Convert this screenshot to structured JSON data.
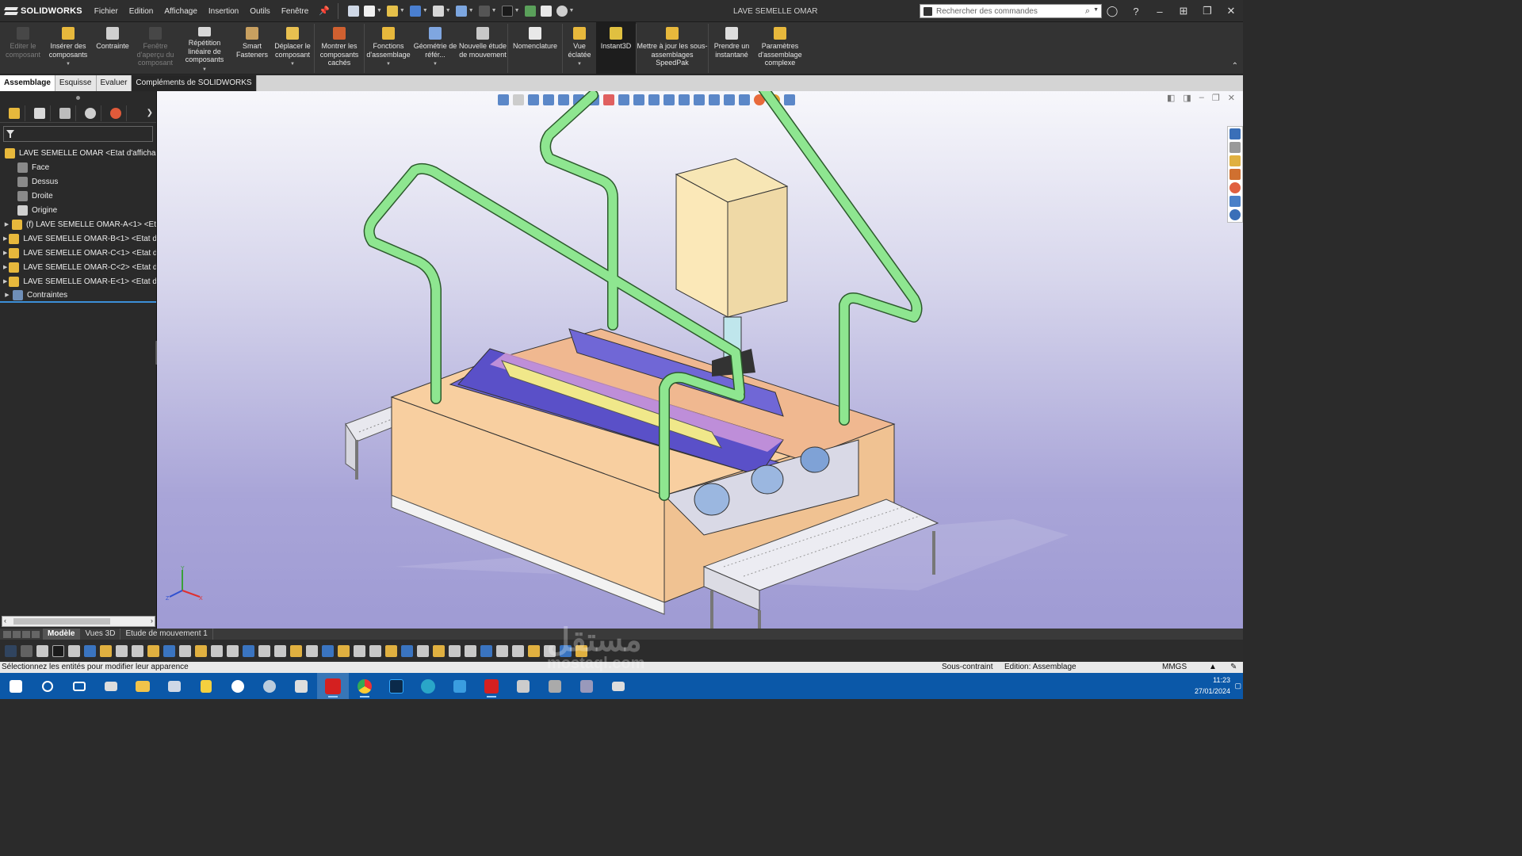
{
  "app": {
    "name": "SOLIDWORKS",
    "document_title": "LAVE SEMELLE OMAR"
  },
  "menu": [
    "Fichier",
    "Edition",
    "Affichage",
    "Insertion",
    "Outils",
    "Fenêtre"
  ],
  "search": {
    "placeholder": "Rechercher des commandes"
  },
  "ribbon": [
    {
      "label": "Editer le composant",
      "disabled": true,
      "icon": "edit-component-icon"
    },
    {
      "label": "Insérer des composants",
      "disabled": false,
      "icon": "insert-components-icon"
    },
    {
      "label": "Contrainte",
      "disabled": false,
      "icon": "mate-icon"
    },
    {
      "label": "Fenêtre d'aperçu du composant",
      "disabled": true,
      "icon": "preview-window-icon"
    },
    {
      "label": "Répétition linéaire de composants",
      "disabled": false,
      "icon": "linear-pattern-icon"
    },
    {
      "label": "Smart Fasteners",
      "disabled": false,
      "icon": "smart-fasteners-icon"
    },
    {
      "label": "Déplacer le composant",
      "disabled": false,
      "icon": "move-component-icon"
    },
    {
      "label": "Montrer les composants cachés",
      "disabled": false,
      "icon": "show-hidden-icon"
    },
    {
      "label": "Fonctions d'assemblage",
      "disabled": false,
      "icon": "assembly-features-icon"
    },
    {
      "label": "Géométrie de référ...",
      "disabled": false,
      "icon": "reference-geometry-icon"
    },
    {
      "label": "Nouvelle étude de mouvement",
      "disabled": false,
      "icon": "motion-study-icon"
    },
    {
      "label": "Nomenclature",
      "disabled": false,
      "icon": "bom-icon"
    },
    {
      "label": "Vue éclatée",
      "disabled": false,
      "icon": "exploded-view-icon"
    },
    {
      "label": "Instant3D",
      "disabled": false,
      "icon": "instant3d-icon",
      "selected": true
    },
    {
      "label": "Mettre à jour les sous-assemblages SpeedPak",
      "disabled": false,
      "icon": "speedpak-icon"
    },
    {
      "label": "Prendre un instantané",
      "disabled": false,
      "icon": "snapshot-icon"
    },
    {
      "label": "Paramètres d'assemblage complexe",
      "disabled": false,
      "icon": "large-assembly-icon"
    }
  ],
  "command_tabs": [
    "Assemblage",
    "Esquisse",
    "Evaluer",
    "Compléments de SOLIDWORKS"
  ],
  "feature_tree": {
    "root": "LAVE SEMELLE OMAR <Etat d'affichage-",
    "items": [
      {
        "label": "Face",
        "icon": "plane-icon",
        "expandable": false
      },
      {
        "label": "Dessus",
        "icon": "plane-icon",
        "expandable": false
      },
      {
        "label": "Droite",
        "icon": "plane-icon",
        "expandable": false
      },
      {
        "label": "Origine",
        "icon": "origin-icon",
        "expandable": false
      },
      {
        "label": "(f) LAVE SEMELLE OMAR-A<1> <Et",
        "icon": "part-icon",
        "expandable": true
      },
      {
        "label": "LAVE SEMELLE OMAR-B<1> <Etat d",
        "icon": "part-icon",
        "expandable": true
      },
      {
        "label": "LAVE SEMELLE OMAR-C<1> <Etat d",
        "icon": "part-icon",
        "expandable": true
      },
      {
        "label": "LAVE SEMELLE OMAR-C<2> <Etat d",
        "icon": "part-icon",
        "expandable": true
      },
      {
        "label": "LAVE SEMELLE OMAR-E<1> <Etat d",
        "icon": "part-icon",
        "expandable": true
      },
      {
        "label": "Contraintes",
        "icon": "mates-folder-icon",
        "expandable": true
      }
    ]
  },
  "bottom_tabs": [
    "Modèle",
    "Vues 3D",
    "Etude de mouvement 1"
  ],
  "status": {
    "message": "Sélectionnez les entités pour modifier leur apparence",
    "constraint": "Sous-contraint",
    "editing": "Edition: Assemblage",
    "units": "MMGS"
  },
  "clock": {
    "time": "11:23",
    "date": "27/01/2024"
  },
  "watermark": {
    "arabic": "مستقل",
    "latin": "mostaql.com"
  },
  "colors": {
    "accent": "#3c8fd8",
    "taskbar": "#0b58a8",
    "rail": "#8ee690",
    "body": "#f8cfa0",
    "brush_blue": "#6b62d8",
    "roller": "#e8e07a"
  }
}
